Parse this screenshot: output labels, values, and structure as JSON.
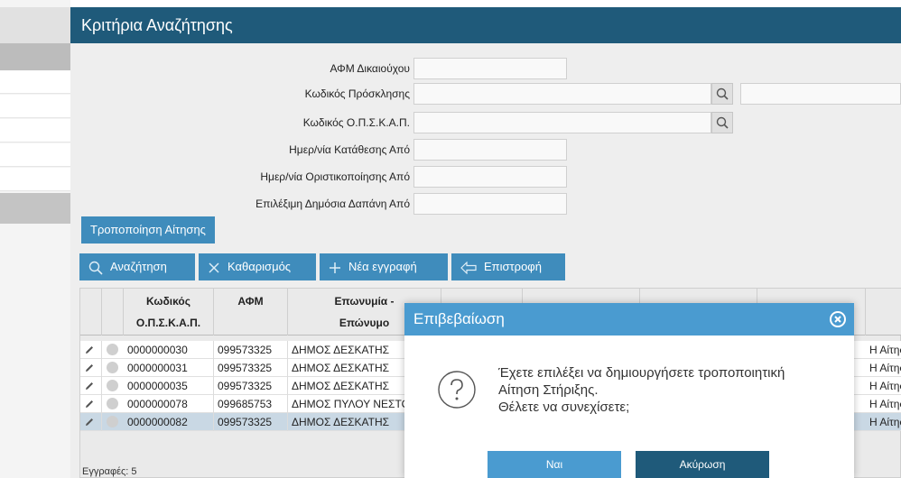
{
  "panel": {
    "title": "Κριτήρια Αναζήτησης"
  },
  "form": {
    "afm_label": "ΑΦΜ Δικαιούχου",
    "invitation_label": "Κωδικός Πρόσκλησης",
    "ops_label": "Κωδικός Ο.Π.Σ.Κ.Α.Π.",
    "submission_date_label": "Ημερ/νία Κατάθεσης Από",
    "finalization_date_label": "Ημερ/νία Οριστικοποίησης Από",
    "eligible_expense_label": "Επιλέξιμη Δημόσια Δαπάνη Από"
  },
  "buttons": {
    "modify": "Τροποποίηση Αίτησης",
    "search": "Αναζήτηση",
    "clear": "Καθαρισμός",
    "new_record": "Νέα εγγραφή",
    "back": "Επιστροφή"
  },
  "grid": {
    "headers": {
      "ops_line1": "Κωδικός",
      "ops_line2": "Ο.Π.Σ.Κ.Α.Π.",
      "afm": "ΑΦΜ",
      "name_line1": "Επωνυμία -",
      "name_line2": "Επώνυμο"
    },
    "rows": [
      {
        "code": "0000000030",
        "afm": "099573325",
        "name": "ΔΗΜΟΣ ΔΕΣΚΑΤΗΣ",
        "status": "Η Αίτησ"
      },
      {
        "code": "0000000031",
        "afm": "099573325",
        "name": "ΔΗΜΟΣ ΔΕΣΚΑΤΗΣ",
        "status": "Η Αίτησ"
      },
      {
        "code": "0000000035",
        "afm": "099573325",
        "name": "ΔΗΜΟΣ ΔΕΣΚΑΤΗΣ",
        "status": "Η Αίτησ"
      },
      {
        "code": "0000000078",
        "afm": "099685753",
        "name": "ΔΗΜΟΣ ΠΥΛΟΥ ΝΕΣΤΟ",
        "status": "Η Αίτησ"
      },
      {
        "code": "0000000082",
        "afm": "099573325",
        "name": "ΔΗΜΟΣ ΔΕΣΚΑΤΗΣ",
        "status": "Η Αίτησ"
      }
    ],
    "records": "Εγγραφές: 5"
  },
  "dialog": {
    "title": "Επιβεβαίωση",
    "line1": "Έχετε επιλέξει να δημιουργήσετε τροποποιητική",
    "line2": "Αίτηση Στήριξης.",
    "line3": "Θέλετε να συνεχίσετε;",
    "yes": "Ναι",
    "cancel": "Ακύρωση"
  },
  "colors": {
    "header": "#1f5a7a",
    "button": "#3f8cbc",
    "dialog_header": "#4a9bd0"
  },
  "icons": [
    "search-icon",
    "close-icon",
    "plus-icon",
    "back-arrow-icon",
    "edit-pencil-icon",
    "question-icon",
    "close-circle-icon"
  ]
}
